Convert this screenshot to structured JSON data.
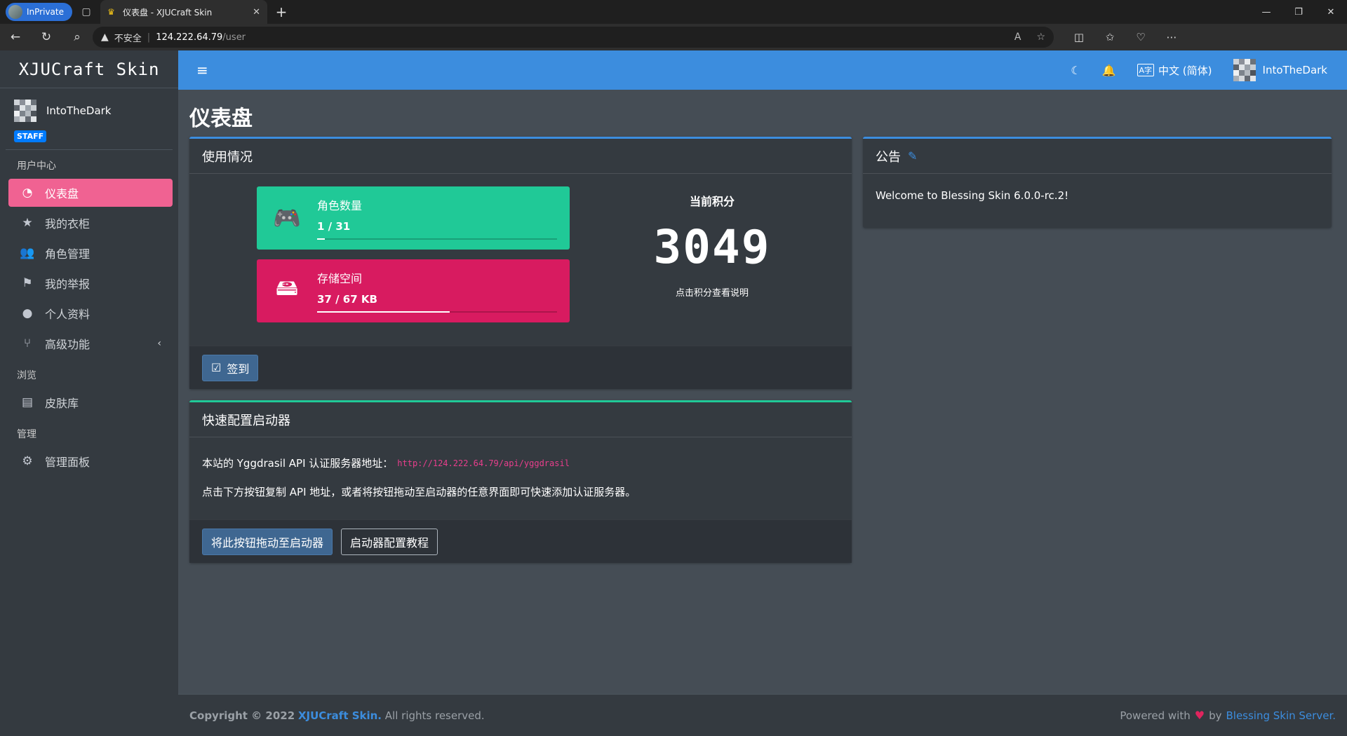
{
  "browser": {
    "inprivate_label": "InPrivate",
    "tab_title": "仪表盘 - XJUCraft Skin",
    "insecure_label": "不安全",
    "url_host": "124.222.64.79",
    "url_path": "/user"
  },
  "sidebar": {
    "brand": "XJUCraft Skin",
    "user_name": "IntoTheDark",
    "staff_badge": "STAFF",
    "sections": {
      "user_center": "用户中心",
      "browse": "浏览",
      "manage": "管理"
    },
    "items": {
      "dashboard": "仪表盘",
      "closet": "我的衣柜",
      "players": "角色管理",
      "reports": "我的举报",
      "profile": "个人资料",
      "advanced": "高级功能",
      "skinlib": "皮肤库",
      "admin": "管理面板"
    }
  },
  "topbar": {
    "language": "中文 (简体)",
    "user_name": "IntoTheDark"
  },
  "page": {
    "title": "仪表盘"
  },
  "usage": {
    "header": "使用情况",
    "roles_label": "角色数量",
    "roles_value": "1 / 31",
    "roles_fraction": 0.032,
    "storage_label": "存储空间",
    "storage_value": "37 / 67 KB",
    "storage_fraction": 0.552,
    "score_label": "当前积分",
    "score_value": "3049",
    "score_hint": "点击积分查看说明",
    "sign_button": "签到"
  },
  "launcher": {
    "header": "快速配置启动器",
    "api_prefix": "本站的 Yggdrasil API 认证服务器地址：",
    "api_url": "http://124.222.64.79/api/yggdrasil",
    "instruction": "点击下方按钮复制 API 地址，或者将按钮拖动至启动器的任意界面即可快速添加认证服务器。",
    "drag_button": "将此按钮拖动至启动器",
    "tutorial_button": "启动器配置教程"
  },
  "announcement": {
    "header": "公告",
    "body": "Welcome to Blessing Skin 6.0.0-rc.2!"
  },
  "footer": {
    "copyright_prefix": "Copyright © 2022",
    "brand": "XJUCraft Skin.",
    "rights": "All rights reserved.",
    "powered_prefix": "Powered with",
    "by": "by",
    "server": "Blessing Skin Server."
  },
  "colors": {
    "topbar": "#3c8dde",
    "sidebar": "#343a40",
    "active_item": "#f06292",
    "roles_box": "#20c997",
    "storage_box": "#d81b60",
    "code": "#e83e8c"
  }
}
